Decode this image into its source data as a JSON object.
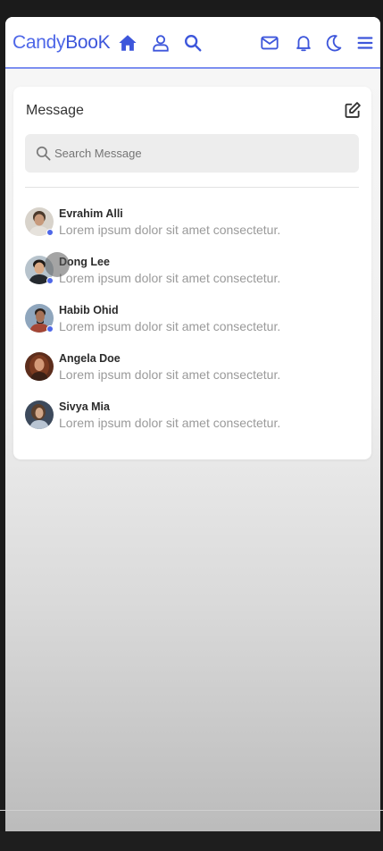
{
  "brand": {
    "part1": "Candy",
    "part2": "BooK"
  },
  "nav_icons": [
    "home-icon",
    "user-icon",
    "search-icon",
    "mail-icon",
    "bell-icon",
    "moon-icon",
    "menu-icon"
  ],
  "colors": {
    "accent": "#4e67e8",
    "name": "#2b2b2b",
    "preview": "#9a9a9a",
    "online": "#4e67e8"
  },
  "panel": {
    "title": "Message",
    "search_placeholder": "Search Message"
  },
  "messages": [
    {
      "name": "Evrahim Alli",
      "preview": "Lorem ipsum dolor sit amet consectetur.",
      "online": true
    },
    {
      "name": "Dong Lee",
      "preview": "Lorem ipsum dolor sit amet consectetur.",
      "online": true
    },
    {
      "name": "Habib Ohid",
      "preview": "Lorem ipsum dolor sit amet consectetur.",
      "online": true
    },
    {
      "name": "Angela Doe",
      "preview": "Lorem ipsum dolor sit amet consectetur.",
      "online": false
    },
    {
      "name": "Sivya Mia",
      "preview": "Lorem ipsum dolor sit amet consectetur.",
      "online": false
    }
  ]
}
